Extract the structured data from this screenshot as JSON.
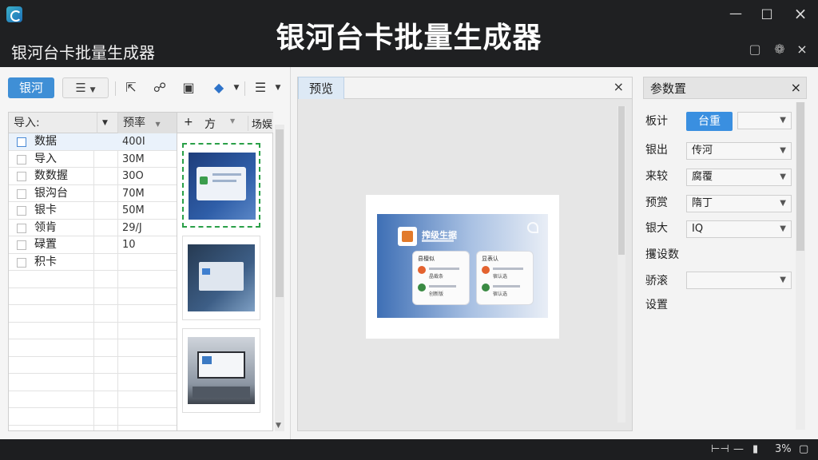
{
  "window": {
    "heading": "银河台卡批量生成器",
    "app_title": "银河台卡批量生成器",
    "min_icon": "minimize-icon",
    "max_icon": "maximize-icon",
    "close_icon": "close-icon"
  },
  "toolbar": {
    "primary_label": "银河",
    "filter_icon": "filter-icon",
    "tools": [
      "cursor-icon",
      "link-icon",
      "crop-icon",
      "fill-icon",
      "list-icon"
    ]
  },
  "grid": {
    "header_col1": "导入:",
    "header_col2": "预率",
    "rows": [
      {
        "name": "数据",
        "value": "400I",
        "checked": true
      },
      {
        "name": "导入",
        "value": "30M"
      },
      {
        "name": "数数握",
        "value": "30O"
      },
      {
        "name": "银沟台",
        "value": "70M"
      },
      {
        "name": "银卡",
        "value": "50M"
      },
      {
        "name": "领肯",
        "value": "29/J"
      },
      {
        "name": "碌置",
        "value": "10"
      },
      {
        "name": "积卡",
        "value": ""
      }
    ]
  },
  "thumbs": {
    "header_plus": "+",
    "header_col": "方",
    "header_col2": "场娱"
  },
  "preview": {
    "tab_label": "预览",
    "card_title": "搾级生据",
    "card_left_title": "县檀似",
    "card_right_title": "显表认",
    "card_left_sub1": "晶裁条",
    "card_left_sub2": "创新版",
    "card_right_sub1": "宿认选",
    "card_right_sub2": "宿认选"
  },
  "props": {
    "title": "参数置",
    "rows": [
      {
        "label": "板计",
        "button": "台重",
        "select": ""
      },
      {
        "label": "银出",
        "select": "传河"
      },
      {
        "label": "来较",
        "select": "腐覆"
      },
      {
        "label": "预赏",
        "select": "隋丁"
      },
      {
        "label": "银大",
        "select": "IQ"
      },
      {
        "label": "攫设数"
      },
      {
        "label": "骄滚",
        "select": ""
      },
      {
        "label": "设置"
      }
    ]
  },
  "status": {
    "zoom": "3%"
  },
  "colors": {
    "accent": "#3f8fd6",
    "title_bg": "#1f2022",
    "selection_dash": "#2aa048"
  }
}
